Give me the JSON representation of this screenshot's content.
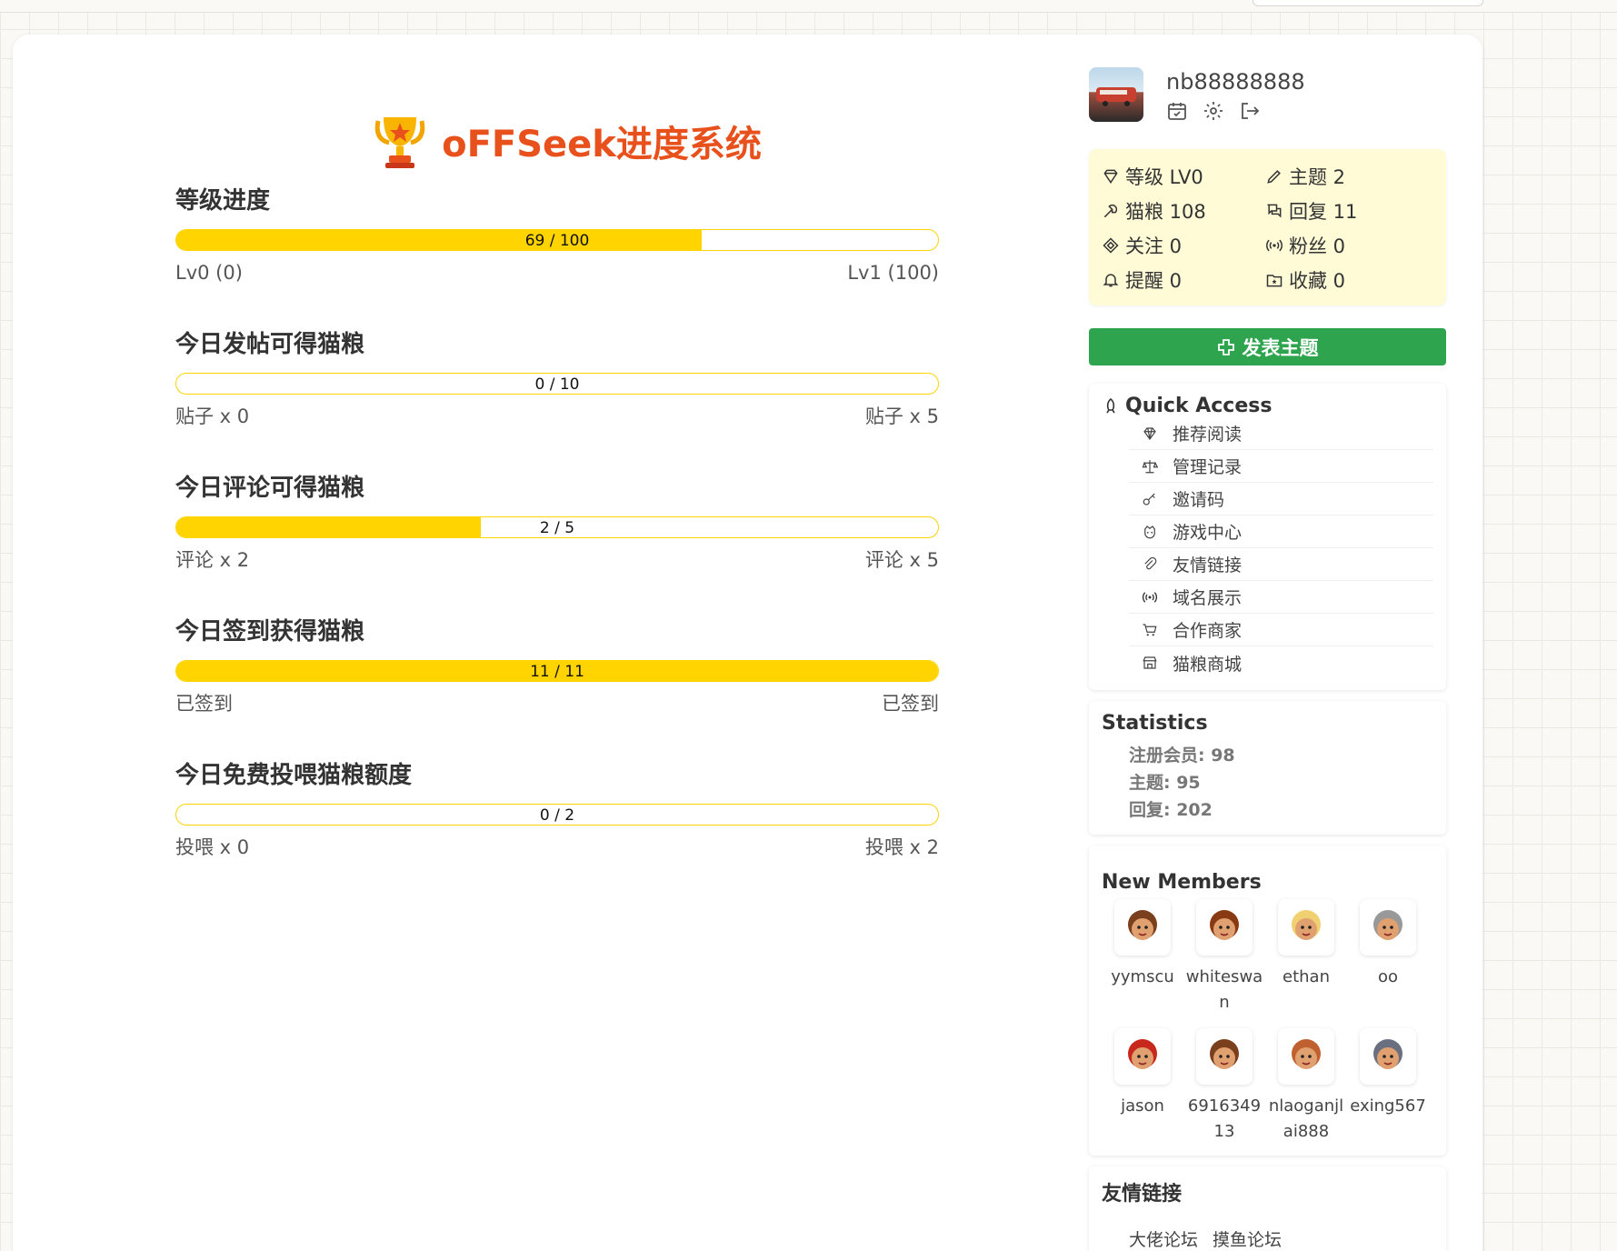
{
  "header": {
    "title": "oFFSeek进度系统"
  },
  "progress": [
    {
      "heading": "等级进度",
      "text": "69 / 100",
      "fraction": 0.69,
      "left_label": "Lv0 (0)",
      "right_label": "Lv1 (100)"
    },
    {
      "heading": "今日发帖可得猫粮",
      "text": "0 / 10",
      "fraction": 0.0,
      "left_label": "贴子 x 0",
      "right_label": "贴子 x 5"
    },
    {
      "heading": "今日评论可得猫粮",
      "text": "2 / 5",
      "fraction": 0.4,
      "left_label": "评论 x 2",
      "right_label": "评论 x 5"
    },
    {
      "heading": "今日签到获得猫粮",
      "text": "11 / 11",
      "fraction": 1.0,
      "left_label": "已签到",
      "right_label": "已签到"
    },
    {
      "heading": "今日免费投喂猫粮额度",
      "text": "0 / 2",
      "fraction": 0.0,
      "left_label": "投喂 x 0",
      "right_label": "投喂 x 2"
    }
  ],
  "user": {
    "name": "nb88888888",
    "icons": [
      "calendar-check-icon",
      "gear-icon",
      "logout-icon"
    ]
  },
  "user_stats": [
    {
      "icon": "diamond-icon",
      "label": "等级 LV0"
    },
    {
      "icon": "pencil-icon",
      "label": "主题 2"
    },
    {
      "icon": "food-icon",
      "label": "猫粮 108"
    },
    {
      "icon": "reply-icon",
      "label": "回复 11"
    },
    {
      "icon": "follow-icon",
      "label": "关注 0"
    },
    {
      "icon": "broadcast-icon",
      "label": "粉丝 0"
    },
    {
      "icon": "bell-icon",
      "label": "提醒 0"
    },
    {
      "icon": "star-folder-icon",
      "label": "收藏 0"
    }
  ],
  "post_button": "发表主题",
  "quick_access": {
    "title": "Quick Access",
    "items": [
      {
        "icon": "gem-icon",
        "label": "推荐阅读"
      },
      {
        "icon": "scale-icon",
        "label": "管理记录"
      },
      {
        "icon": "key-icon",
        "label": "邀请码"
      },
      {
        "icon": "game-icon",
        "label": "游戏中心"
      },
      {
        "icon": "paperclip-icon",
        "label": "友情链接"
      },
      {
        "icon": "broadcast-icon",
        "label": "域名展示"
      },
      {
        "icon": "cart-icon",
        "label": "合作商家"
      },
      {
        "icon": "store-icon",
        "label": "猫粮商城"
      }
    ]
  },
  "statistics": {
    "title": "Statistics",
    "lines": [
      "注册会员: 98",
      "主题: 95",
      "回复: 202"
    ]
  },
  "new_members": {
    "title": "New Members",
    "members": [
      {
        "name": "yymscu",
        "color": "#7a3f1d"
      },
      {
        "name": "whiteswan",
        "color": "#8a3a12"
      },
      {
        "name": "ethan",
        "color": "#f0d070"
      },
      {
        "name": "oo",
        "color": "#999999"
      },
      {
        "name": "jason",
        "color": "#c8281c"
      },
      {
        "name": "691634913",
        "color": "#7a3f1d"
      },
      {
        "name": "nlaoganjlai888",
        "color": "#c06030"
      },
      {
        "name": "exing567",
        "color": "#6a7080"
      }
    ]
  },
  "friend_links": {
    "title": "友情链接",
    "links": [
      "大佬论坛",
      "摸鱼论坛"
    ]
  },
  "colors": {
    "title": "#e8501c",
    "bar_fill": "#ffd400",
    "stats_bg": "#fefbd6",
    "post_button": "#2fa44f"
  }
}
